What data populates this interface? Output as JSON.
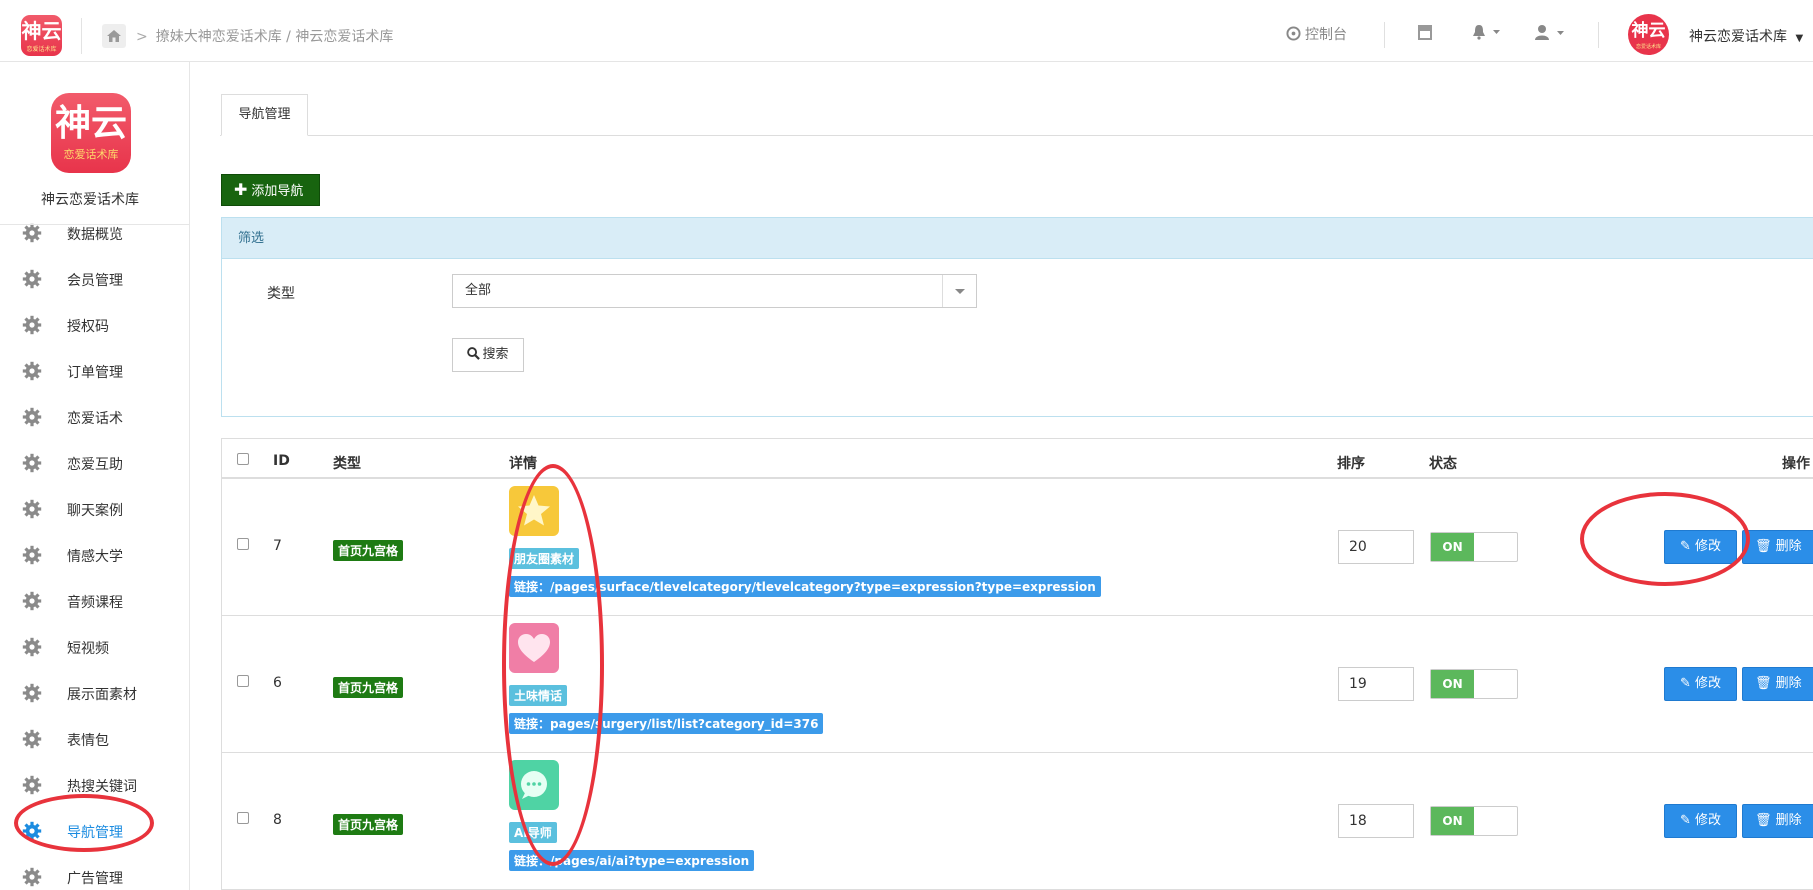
{
  "colors": {
    "brand": "#e8344b",
    "accent": "#2b8ee8",
    "success": "#5cb85c",
    "add_button": "#18640f",
    "annotation": "#e8333c"
  },
  "logo": {
    "text": "神云",
    "subtext": "恋爱话术库"
  },
  "breadcrumb": {
    "text": "撩妹大神恋爱话术库 / 神云恋爱话术库"
  },
  "topbar": {
    "console_label": "控制台",
    "user_name": "神云恋爱话术库",
    "icons": [
      "console-icon",
      "store-icon",
      "bell-icon",
      "user-icon"
    ]
  },
  "sidebar": {
    "brand": "神云恋爱话术库",
    "items": [
      {
        "label": "数据概览"
      },
      {
        "label": "会员管理"
      },
      {
        "label": "授权码"
      },
      {
        "label": "订单管理"
      },
      {
        "label": "恋爱话术"
      },
      {
        "label": "恋爱互助"
      },
      {
        "label": "聊天案例"
      },
      {
        "label": "情感大学"
      },
      {
        "label": "音频课程"
      },
      {
        "label": "短视频"
      },
      {
        "label": "展示面素材"
      },
      {
        "label": "表情包"
      },
      {
        "label": "热搜关键词"
      },
      {
        "label": "导航管理"
      },
      {
        "label": "广告管理"
      }
    ]
  },
  "main": {
    "tab_label": "导航管理",
    "add_button": "添加导航",
    "filter": {
      "title": "筛选",
      "type_label": "类型",
      "type_value": "全部",
      "search_button": "搜索"
    },
    "table": {
      "headers": [
        "ID",
        "类型",
        "详情",
        "排序",
        "状态",
        "操作"
      ],
      "rows": [
        {
          "id": "7",
          "type": "首页九宫格",
          "name": "朋友圈素材",
          "link": "链接：/pages/surface/tlevelcategory/tlevelcategory?type=expression?type=expression",
          "sort": "20",
          "status": "ON",
          "icon": "star-icon",
          "icon_color": "#f7c83a"
        },
        {
          "id": "6",
          "type": "首页九宫格",
          "name": "土味情话",
          "link": "链接：pages/surgery/list/list?category_id=376",
          "sort": "19",
          "status": "ON",
          "icon": "heart-icon",
          "icon_color": "#f07ea6"
        },
        {
          "id": "8",
          "type": "首页九宫格",
          "name": "AI导师",
          "link": "链接：/pages/ai/ai?type=expression",
          "sort": "18",
          "status": "ON",
          "icon": "chat-icon",
          "icon_color": "#4fd3a4"
        }
      ],
      "edit_label": "修改",
      "delete_label": "删除"
    }
  }
}
